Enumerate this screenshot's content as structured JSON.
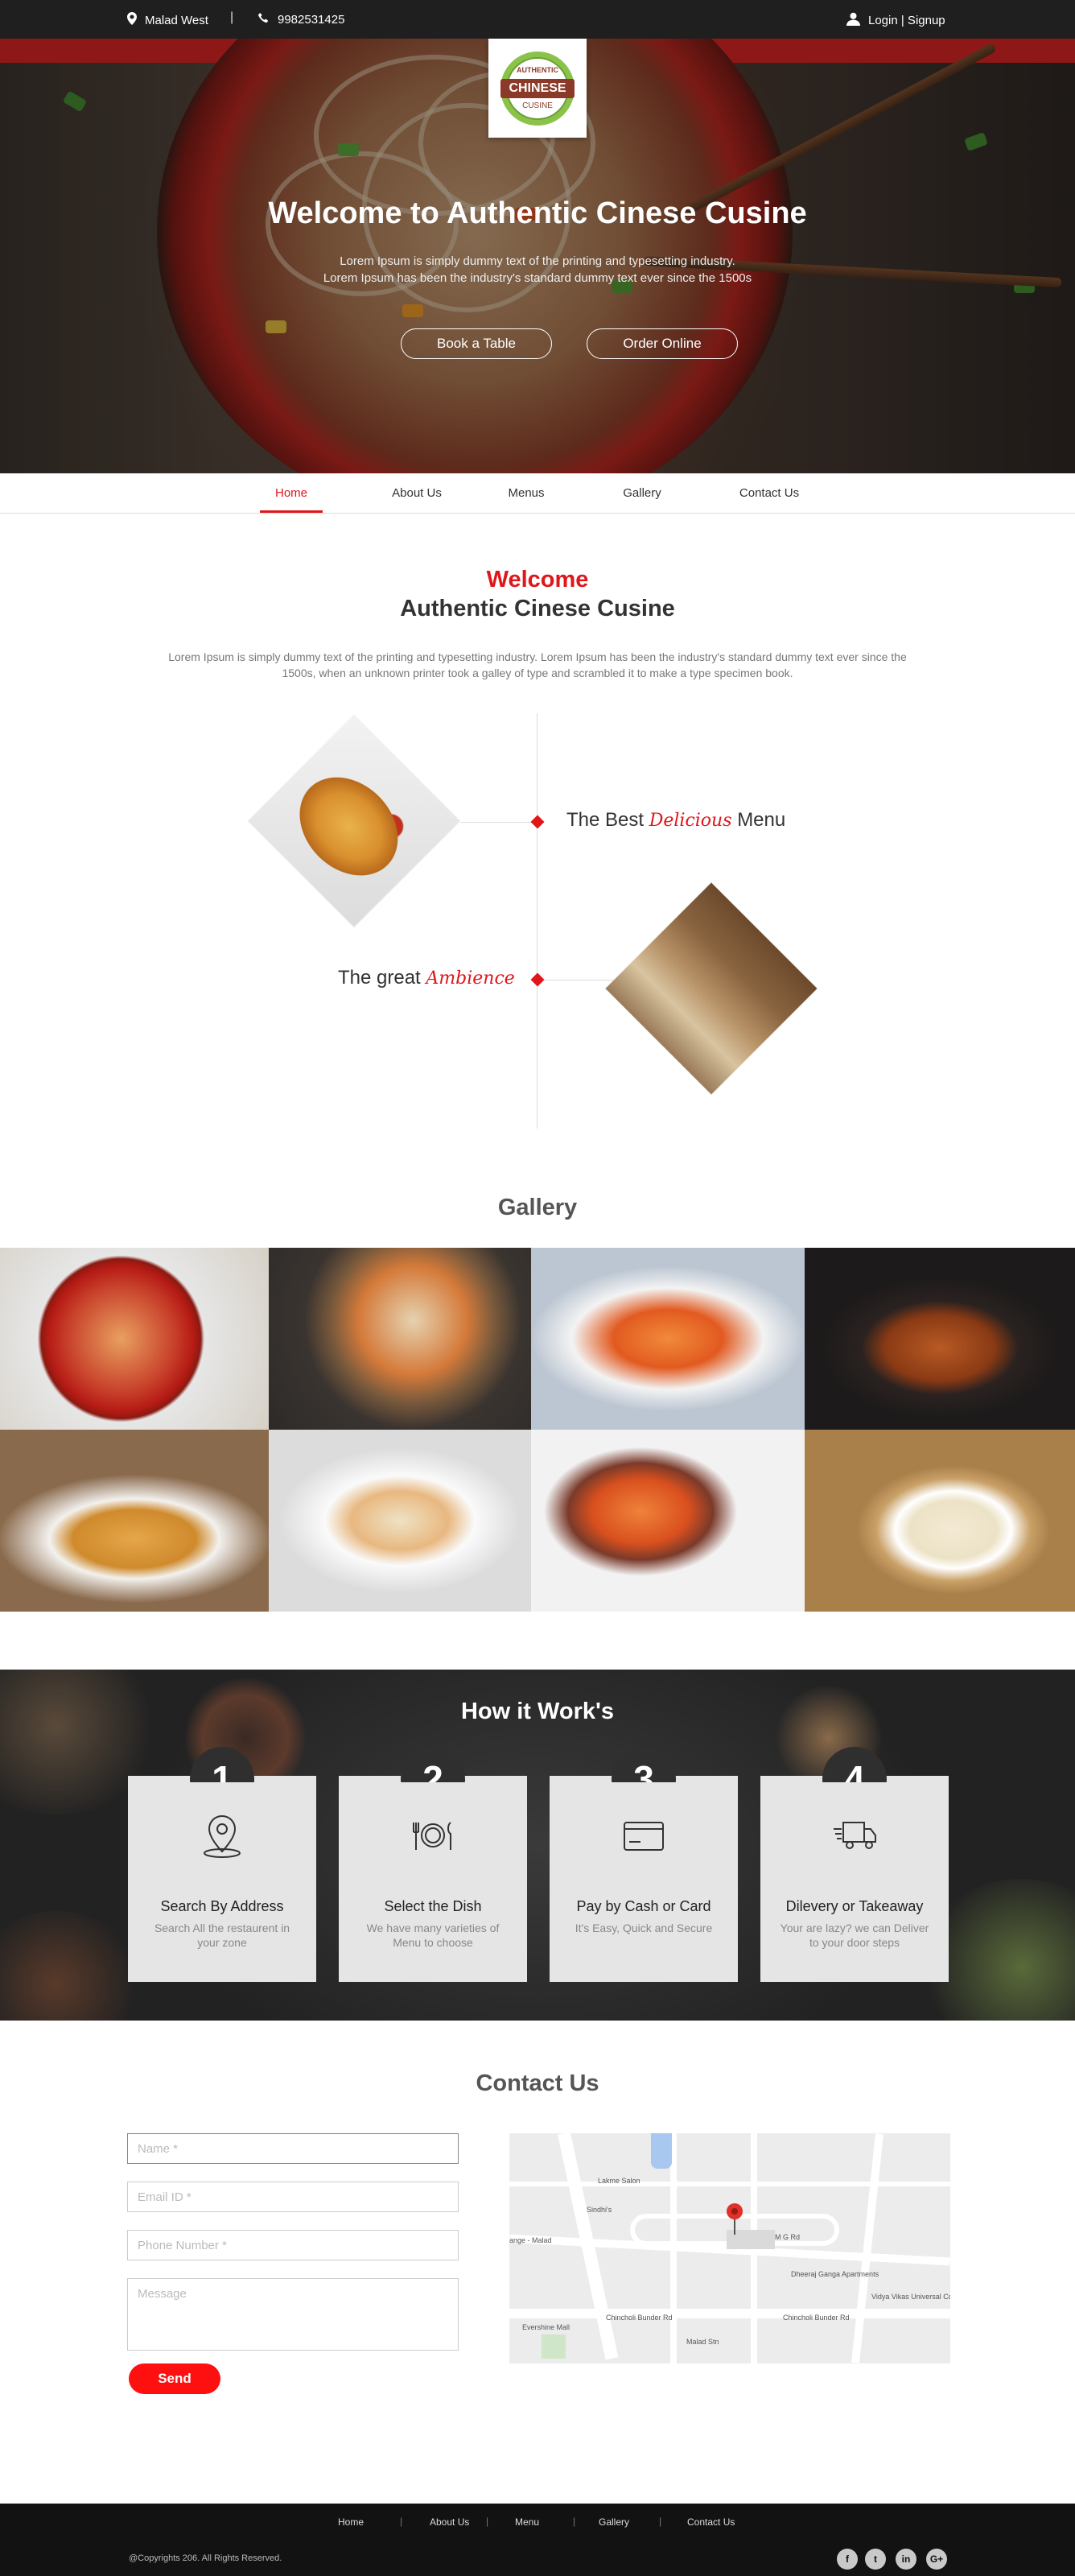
{
  "topbar": {
    "location": "Malad West",
    "separator": "|",
    "phone": "9982531425",
    "login": "Login | Signup"
  },
  "logo": {
    "line1": "AUTHENTIC",
    "line2": "CHINESE",
    "line3": "CUSINE"
  },
  "hero": {
    "title": "Welcome to Authentic Cinese Cusine",
    "line1": "Lorem Ipsum is simply dummy text of the printing and typesetting industry.",
    "line2": "Lorem Ipsum has been the industry's standard dummy text ever since the 1500s",
    "btn_book": "Book a Table",
    "btn_order": "Order Online"
  },
  "nav": {
    "items": [
      "Home",
      "About Us",
      "Menus",
      "Gallery",
      "Contact Us"
    ],
    "active": "Home"
  },
  "welcome": {
    "title_red": "Welcome",
    "title_dark": "Authentic Cinese Cusine",
    "text": "Lorem Ipsum is simply dummy text of the printing and typesetting industry. Lorem Ipsum has been the industry's standard dummy text ever since the 1500s, when an unknown printer took a galley of type and scrambled it to make a type specimen book."
  },
  "features": [
    {
      "prefix": "The Best",
      "script": "Delicious",
      "suffix": "Menu"
    },
    {
      "prefix": "The great",
      "script": "Ambience",
      "suffix": ""
    }
  ],
  "gallery": {
    "title": "Gallery"
  },
  "how": {
    "title": "How it Work's",
    "steps": [
      {
        "num": "1",
        "icon": "map-pin-icon",
        "title": "Search By Address",
        "desc": "Search All the restaurent in your zone"
      },
      {
        "num": "2",
        "icon": "plate-cutlery-icon",
        "title": "Select the Dish",
        "desc": "We have many varieties of Menu to choose"
      },
      {
        "num": "3",
        "icon": "credit-card-icon",
        "title": "Pay by Cash or Card",
        "desc": "It's Easy, Quick and Secure"
      },
      {
        "num": "4",
        "icon": "delivery-truck-icon",
        "title": "Dilevery or Takeaway",
        "desc": "Your are lazy? we can Deliver to your door steps"
      }
    ]
  },
  "contact": {
    "title": "Contact Us",
    "name_placeholder": "Name *",
    "email_placeholder": "Email ID *",
    "phone_placeholder": "Phone Number *",
    "message_placeholder": "Message",
    "send": "Send",
    "map_labels": [
      "Lakme Salon",
      "Sindhi's",
      "ange - Malad",
      "Dheeraj Ganga Apartments",
      "Vidya Vikas Universal College",
      "Evershine Mall",
      "Chincholi Bunder Rd",
      "Chincholi Bunder Rd",
      "M G Rd",
      "Malad Stn"
    ]
  },
  "footer": {
    "links": [
      "Home",
      "About Us",
      "Menu",
      "Gallery",
      "Contact Us"
    ],
    "copyright": "@Copyrights 206. All Rights Reserved.",
    "social": [
      "facebook-icon",
      "twitter-icon",
      "linkedin-icon",
      "google-plus-icon"
    ]
  },
  "colors": {
    "accent": "#e0161a",
    "dark": "#1f1f1f",
    "card": "#e5e5e5"
  }
}
